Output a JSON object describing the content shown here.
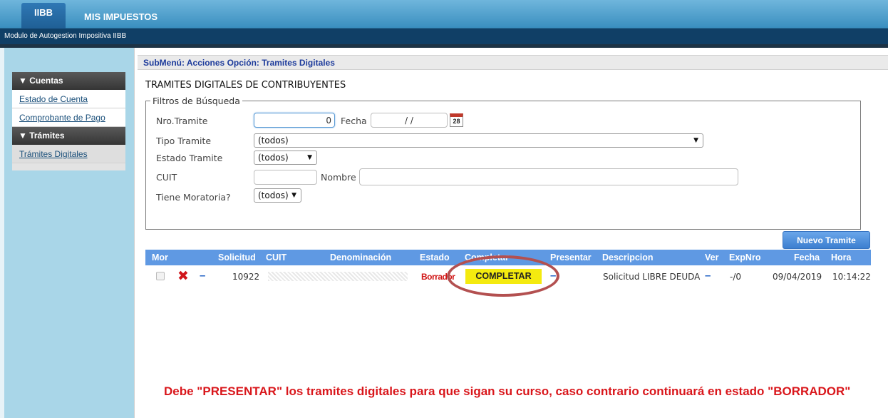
{
  "header": {
    "tabs": [
      "IIBB",
      "MIS IMPUESTOS"
    ],
    "subtitle": "Modulo de Autogestion Impositiva IIBB"
  },
  "sidebar": {
    "sections": [
      {
        "title": "▼ Cuentas",
        "items": [
          "Estado de Cuenta",
          "Comprobante de Pago"
        ]
      },
      {
        "title": "▼ Trámites",
        "items": [
          "Trámites Digitales"
        ]
      }
    ]
  },
  "submenu": "SubMenú: Acciones Opción: Tramites Digitales",
  "page_title": "TRAMITES DIGITALES DE CONTRIBUYENTES",
  "filters": {
    "legend": "Filtros de Búsqueda",
    "nro_tramite_label": "Nro.Tramite",
    "nro_tramite_value": "0",
    "fecha_label": "Fecha",
    "fecha_value": "/ /",
    "calendar_label": "28",
    "tipo_label": "Tipo Tramite",
    "tipo_value": "(todos)",
    "estado_label": "Estado Tramite",
    "estado_value": "(todos)",
    "cuit_label": "CUIT",
    "cuit_value": "",
    "nombre_label": "Nombre",
    "nombre_value": "",
    "moratoria_label": "Tiene Moratoria?",
    "moratoria_value": "(todos)"
  },
  "actions": {
    "nuevo_tramite": "Nuevo Tramite"
  },
  "table": {
    "columns": [
      "Mor",
      "Solicitud",
      "CUIT",
      "Denominación",
      "Estado",
      "Completar",
      "Presentar",
      "Descripcion",
      "Ver",
      "ExpNro",
      "Fecha",
      "Hora"
    ],
    "rows": [
      {
        "solicitud": "10922",
        "estado": "Borrador",
        "completar": "COMPLETAR",
        "presentar": "–",
        "descripcion": "Solicitud LIBRE DEUDA",
        "ver": "–",
        "expnro": "-/0",
        "fecha": "09/04/2019",
        "hora": "10:14:22"
      }
    ]
  },
  "note": "Debe \"PRESENTAR\" los tramites digitales para que sigan su curso, caso contrario continuará en estado \"BORRADOR\"",
  "colors": {
    "accent": "#5f99e3",
    "highlight": "#f4ea0f",
    "alert": "#d9161b",
    "oval": "#b35050"
  }
}
